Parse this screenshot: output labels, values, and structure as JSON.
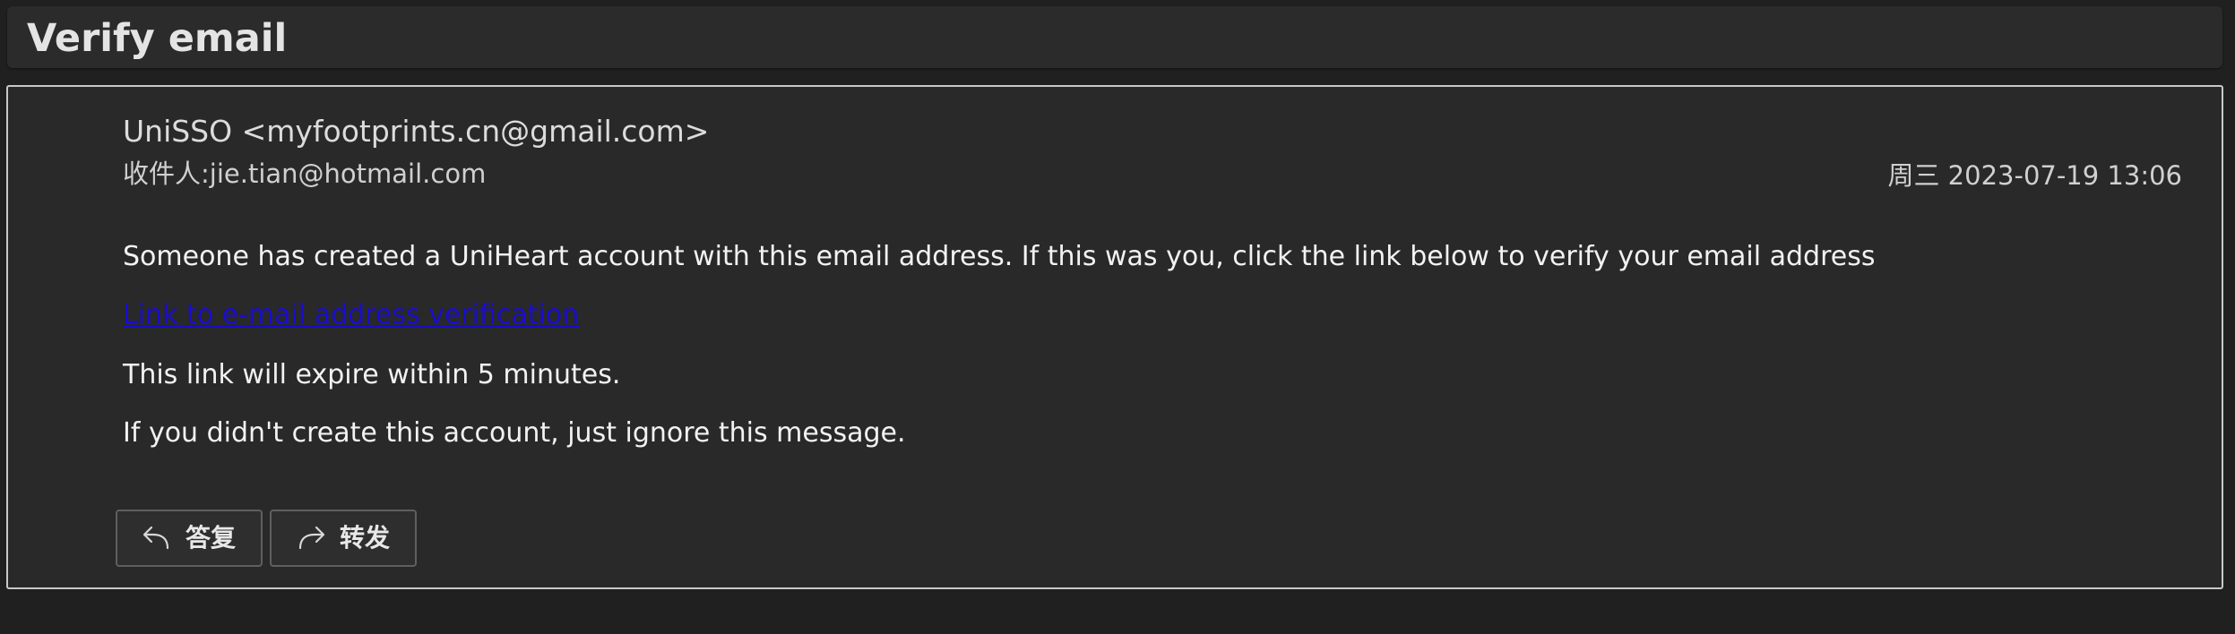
{
  "header": {
    "subject": "Verify email"
  },
  "message": {
    "sender": "UniSSO <myfootprints.cn@gmail.com>",
    "recipient_label": "收件人:",
    "recipient": "jie.tian@hotmail.com",
    "date": "周三 2023-07-19 13:06",
    "body": {
      "line1": "Someone has created a UniHeart account with this email address. If this was you, click the link below to verify your email address",
      "link_text": "Link to e-mail address verification",
      "line3": "This link will expire within 5 minutes.",
      "line4": "If you didn't create this account, just ignore this message."
    },
    "link_color": "#1a0dcc"
  },
  "actions": {
    "reply_label": "答复",
    "reply_icon": "reply-arrow-icon",
    "forward_label": "转发",
    "forward_icon": "forward-arrow-icon"
  }
}
